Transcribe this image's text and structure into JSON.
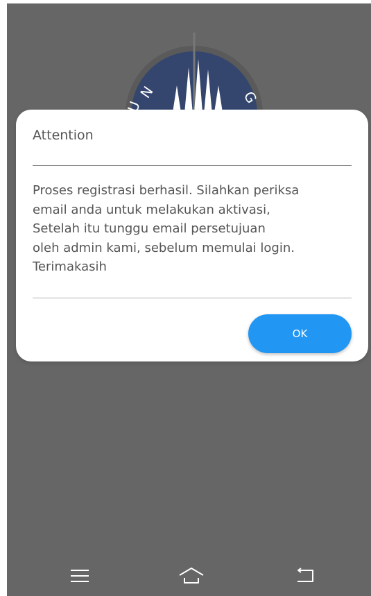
{
  "dialog": {
    "title": "Attention",
    "message": "Proses registrasi berhasil. Silahkan periksa\nemail anda untuk melakukan aktivasi,\nSetelah itu tunggu email persetujuan\noleh admin kami, sebelum memulai login.\nTerimakasih",
    "ok_label": "OK"
  },
  "background": {
    "logo_icon": "university-logo-icon"
  },
  "navbar": {
    "items": [
      {
        "icon": "menu-icon"
      },
      {
        "icon": "home-icon"
      },
      {
        "icon": "back-icon"
      }
    ]
  },
  "colors": {
    "overlay": "#666666",
    "accent": "#2196f3",
    "dialog_bg": "#ffffff",
    "text": "#555555"
  }
}
